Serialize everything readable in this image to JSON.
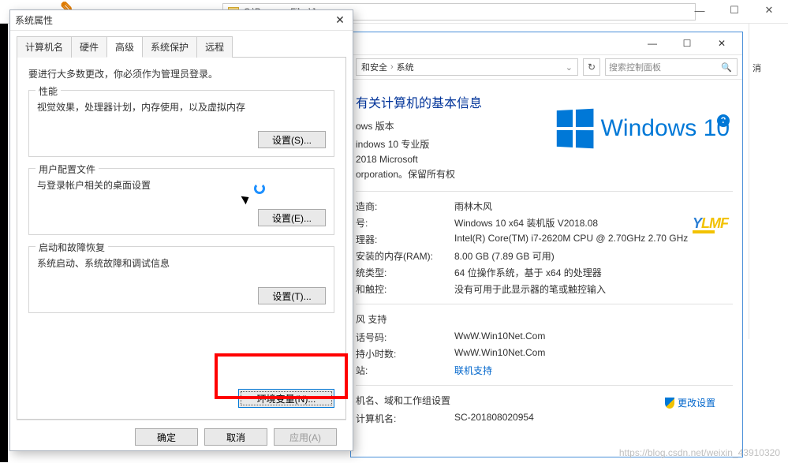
{
  "explorer": {
    "path": "C:\\Program Files\\Java",
    "refresh_icon": "↻",
    "min": "—",
    "max": "☐",
    "close": "✕",
    "side_hint": "消"
  },
  "sysinfo": {
    "breadcrumb": {
      "seg1": "和安全",
      "seg2": "系统"
    },
    "search_placeholder": "搜索控制面板",
    "heading": "有关计算机的基本信息",
    "edition_label": "ows 版本",
    "edition_value": "indows 10 专业版",
    "copyright1": "2018 Microsoft",
    "copyright2": "orporation。保留所有权",
    "win10_text": "Windows 10",
    "sys_group": {
      "manufacturer_k": "造商:",
      "manufacturer_v": "雨林木风",
      "model_k": "号:",
      "model_v": "Windows 10 x64 装机版 V2018.08",
      "cpu_k": "理器:",
      "cpu_v": "Intel(R) Core(TM) i7-2620M CPU @ 2.70GHz   2.70 GHz",
      "ram_k": "安装的内存(RAM):",
      "ram_v": "8.00 GB (7.89 GB 可用)",
      "type_k": "统类型:",
      "type_v": "64 位操作系统，基于 x64 的处理器",
      "pen_k": "和触控:",
      "pen_v": "没有可用于此显示器的笔或触控输入"
    },
    "support_hdr": "风 支持",
    "support": {
      "phone_k": "话号码:",
      "phone_v": "WwW.Win10Net.Com",
      "hours_k": "持小时数:",
      "hours_v": "WwW.Win10Net.Com",
      "site_k": "站:",
      "site_v": "联机支持"
    },
    "domain_hdr": "机名、域和工作组设置",
    "computer_name_k": "计算机名:",
    "computer_name_v": "SC-201808020954",
    "change_settings": "更改设置"
  },
  "sysprops": {
    "title": "系统属性",
    "tabs": {
      "computer_name": "计算机名",
      "hardware": "硬件",
      "advanced": "高级",
      "protection": "系统保护",
      "remote": "远程"
    },
    "admin_note": "要进行大多数更改，你必须作为管理员登录。",
    "perf": {
      "legend": "性能",
      "desc": "视觉效果，处理器计划，内存使用，以及虚拟内存",
      "btn": "设置(S)..."
    },
    "userprofile": {
      "legend": "用户配置文件",
      "desc": "与登录帐户相关的桌面设置",
      "btn": "设置(E)..."
    },
    "startup": {
      "legend": "启动和故障恢复",
      "desc": "系统启动、系统故障和调试信息",
      "btn": "设置(T)..."
    },
    "env_btn": "环境变量(N)...",
    "ok": "确定",
    "cancel": "取消",
    "apply": "应用(A)"
  },
  "watermark": "https://blog.csdn.net/weixin_43910320"
}
